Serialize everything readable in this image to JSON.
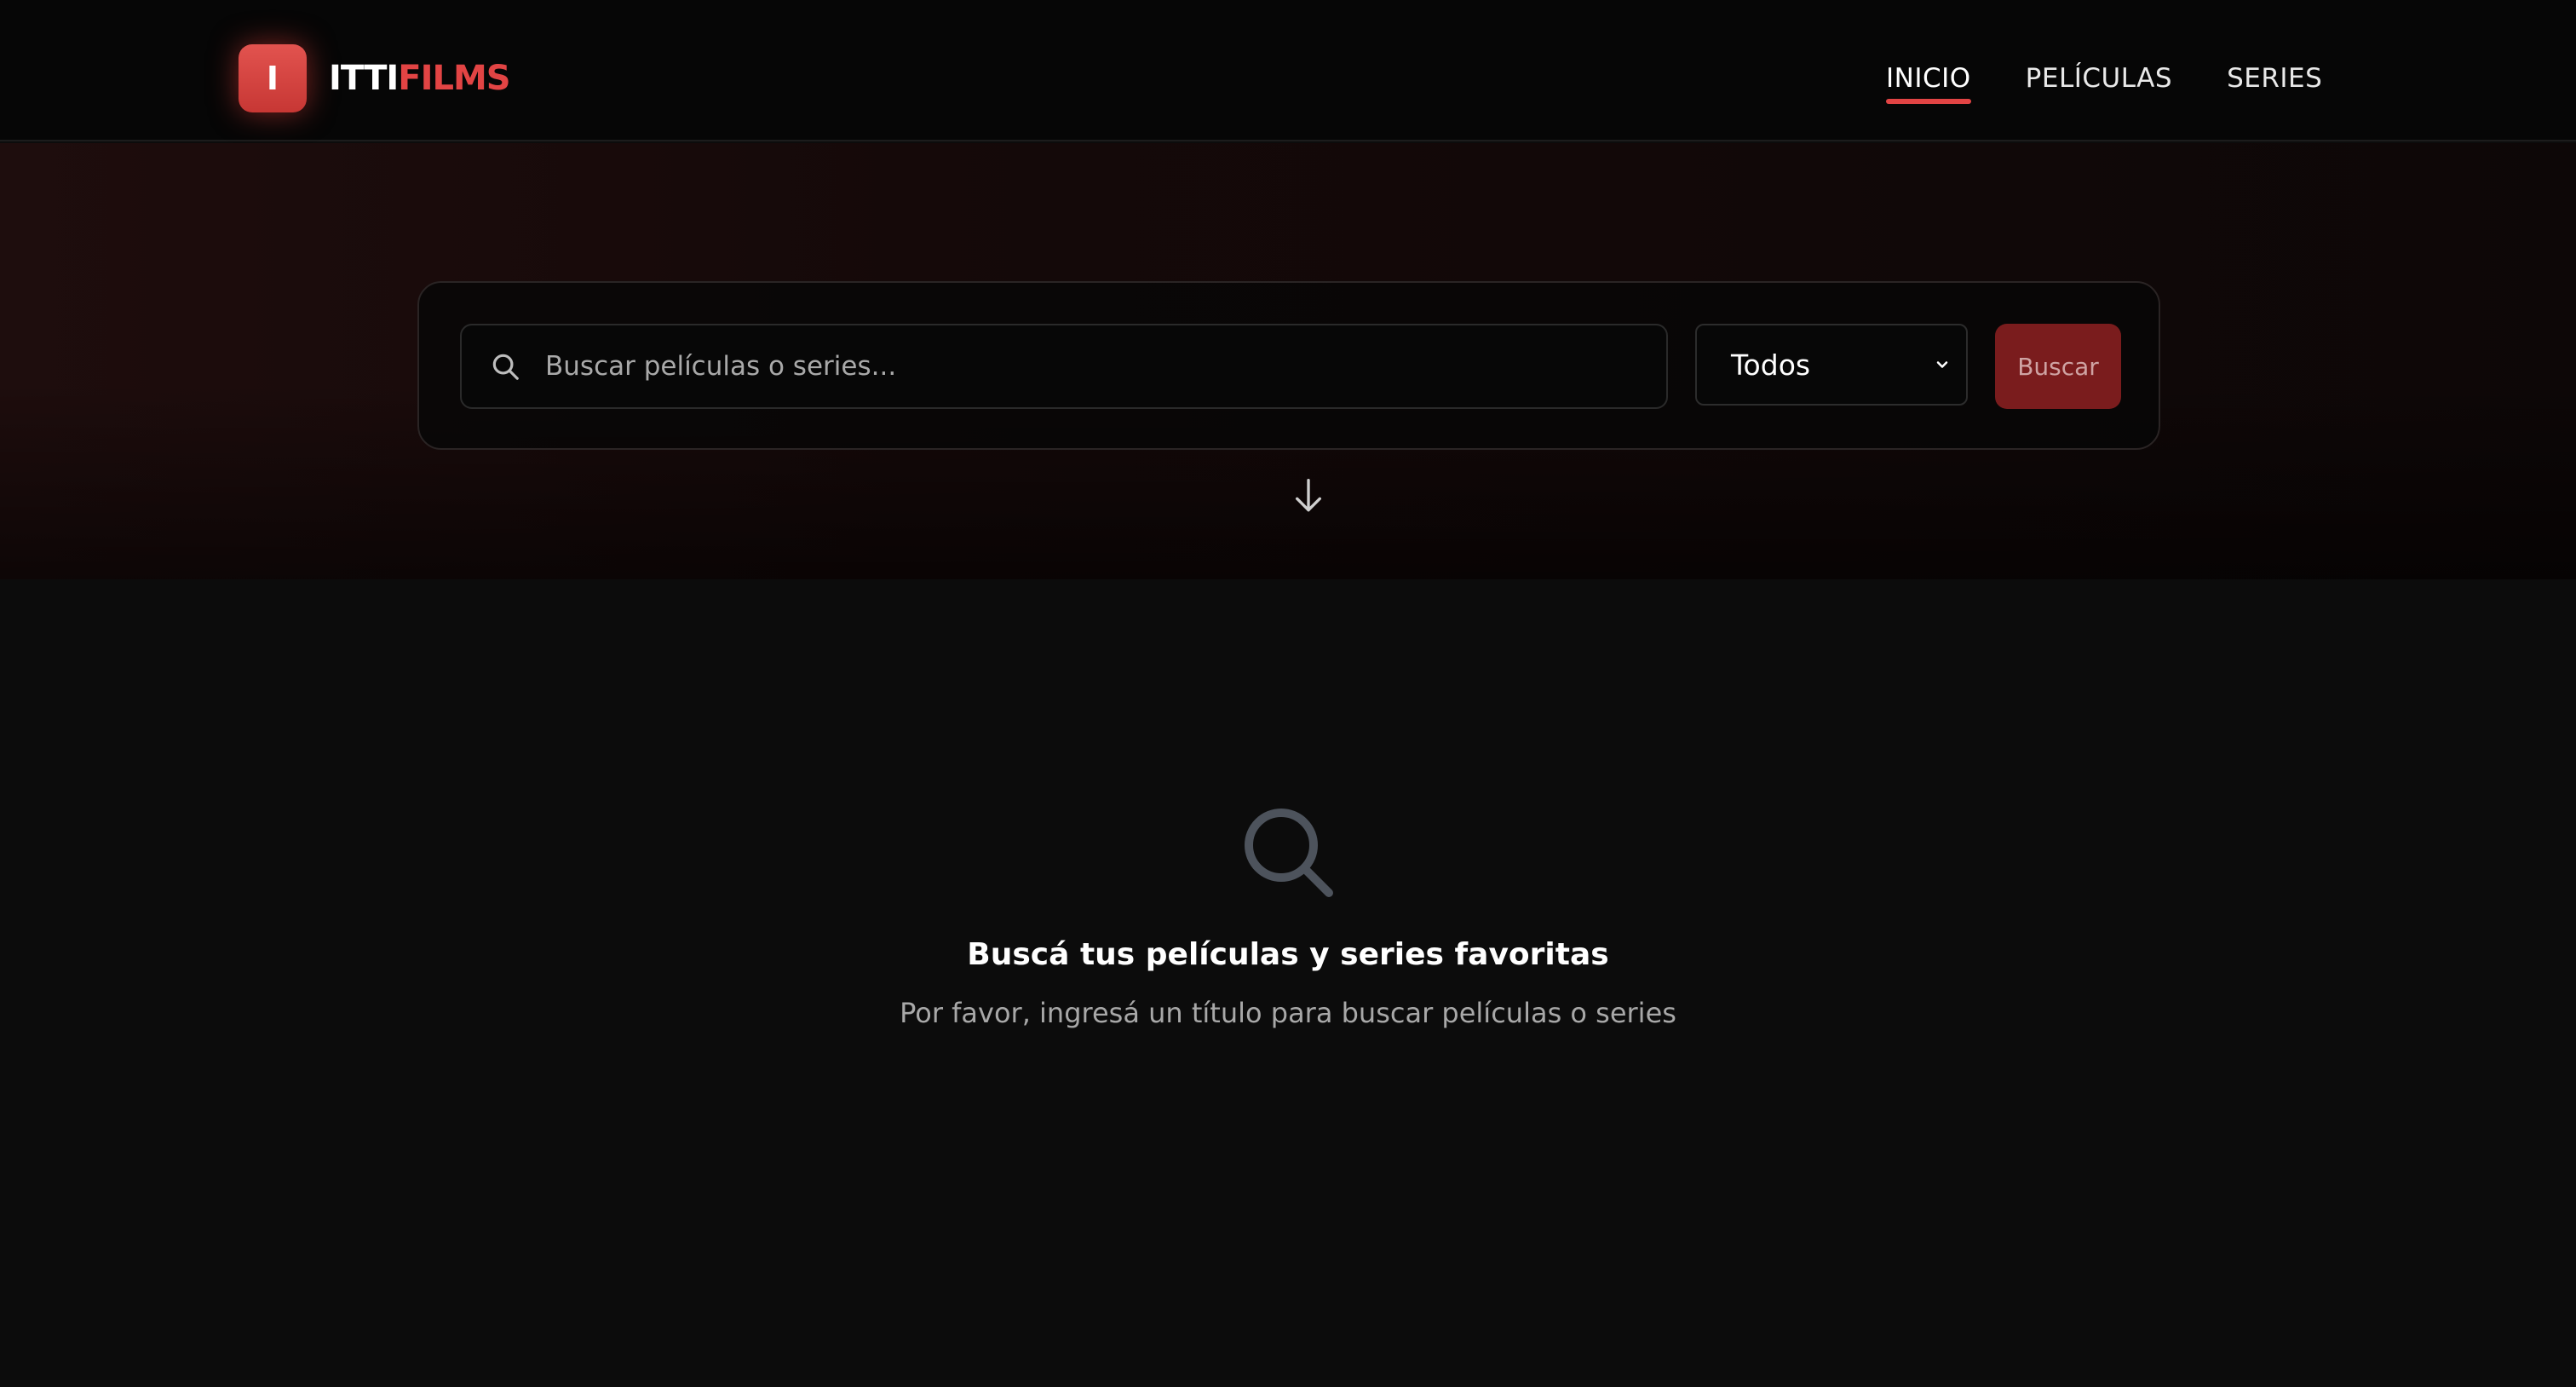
{
  "brand": {
    "badge_letter": "I",
    "name_part1": "ITTI",
    "name_part2": "FILMS",
    "accent_color": "#e24444"
  },
  "nav": {
    "items": [
      {
        "label": "INICIO",
        "active": true
      },
      {
        "label": "PELÍCULAS",
        "active": false
      },
      {
        "label": "SERIES",
        "active": false
      }
    ]
  },
  "search": {
    "placeholder": "Buscar películas o series...",
    "value": "",
    "type_selected": "Todos",
    "button_label": "Buscar",
    "search_icon": "search-icon",
    "dropdown_icon": "chevron-down-icon",
    "scroll_icon": "arrow-down-icon"
  },
  "empty_state": {
    "icon": "search-icon",
    "title": "Buscá tus películas y series favoritas",
    "subtitle": "Por favor, ingresá un título para buscar películas o series"
  }
}
